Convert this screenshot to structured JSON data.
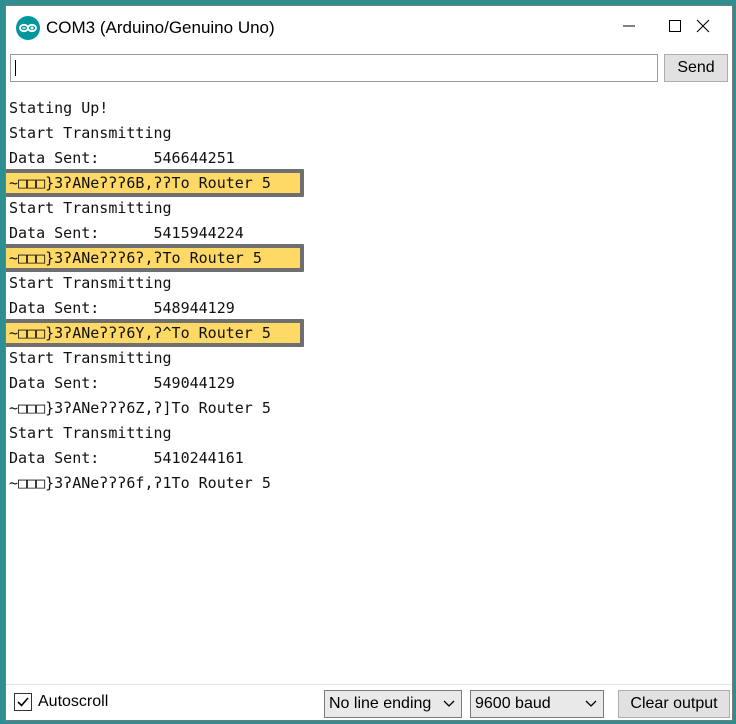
{
  "window": {
    "title": "COM3 (Arduino/Genuino Uno)",
    "icon": "arduino-logo-icon",
    "controls": [
      "minimize-icon",
      "maximize-icon",
      "close-icon"
    ]
  },
  "toolbar": {
    "input_value": "",
    "send_label": "Send"
  },
  "output": {
    "lines": [
      {
        "text": "Stating Up!",
        "highlighted": false
      },
      {
        "text": "Start Transmitting",
        "highlighted": false
      },
      {
        "text": "Data Sent:      546644251",
        "highlighted": false
      },
      {
        "text": "~□□□}3ʔANeʔʔʔ6B,ʔʔTo Router 5",
        "highlighted": true
      },
      {
        "text": "Start Transmitting",
        "highlighted": false
      },
      {
        "text": "Data Sent:      5415944224",
        "highlighted": false
      },
      {
        "text": "~□□□}3ʔANeʔʔʔ6ʔ,ʔTo Router 5",
        "highlighted": true
      },
      {
        "text": "Start Transmitting",
        "highlighted": false
      },
      {
        "text": "Data Sent:      548944129",
        "highlighted": false
      },
      {
        "text": "~□□□}3ʔANeʔʔʔ6Y,ʔ^To Router 5",
        "highlighted": true
      },
      {
        "text": "Start Transmitting",
        "highlighted": false
      },
      {
        "text": "Data Sent:      549044129",
        "highlighted": false
      },
      {
        "text": "~□□□}3ʔANeʔʔʔ6Z,ʔ]To Router 5",
        "highlighted": false
      },
      {
        "text": "Start Transmitting",
        "highlighted": false
      },
      {
        "text": "Data Sent:      5410244161",
        "highlighted": false
      },
      {
        "text": "~□□□}3ʔANeʔʔʔ6f,ʔ1To Router 5",
        "highlighted": false
      }
    ],
    "highlight_colors": {
      "border": "#6f6f6f",
      "fill": "#ffd966"
    }
  },
  "footer": {
    "autoscroll_label": "Autoscroll",
    "autoscroll_checked": true,
    "line_ending": "No line ending",
    "baud": "9600 baud",
    "clear_label": "Clear output"
  }
}
